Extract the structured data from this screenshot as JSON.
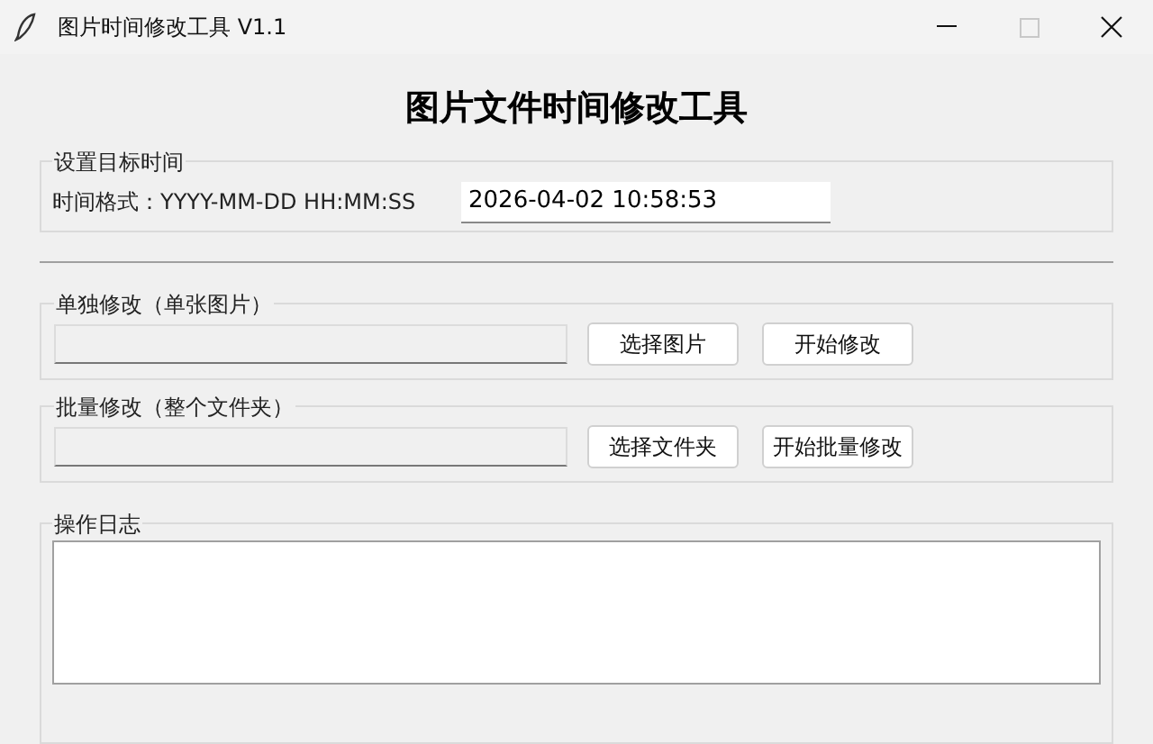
{
  "window": {
    "title": "图片时间修改工具 V1.1",
    "controls": [
      {
        "kind": "minimize",
        "disabled": false
      },
      {
        "kind": "maximize",
        "disabled": true
      },
      {
        "kind": "close",
        "disabled": false
      }
    ]
  },
  "heading": "图片文件时间修改工具",
  "target_time": {
    "legend": "设置目标时间",
    "format_label": "时间格式：YYYY-MM-DD HH:MM:SS",
    "value": "2026-04-02 10:58:53"
  },
  "single": {
    "legend": "单独修改（单张图片）",
    "buttons": [
      "选择图片",
      "开始修改"
    ]
  },
  "batch": {
    "legend": "批量修改（整个文件夹）",
    "buttons": [
      "选择文件夹",
      "开始批量修改"
    ]
  },
  "log": {
    "legend": "操作日志"
  }
}
